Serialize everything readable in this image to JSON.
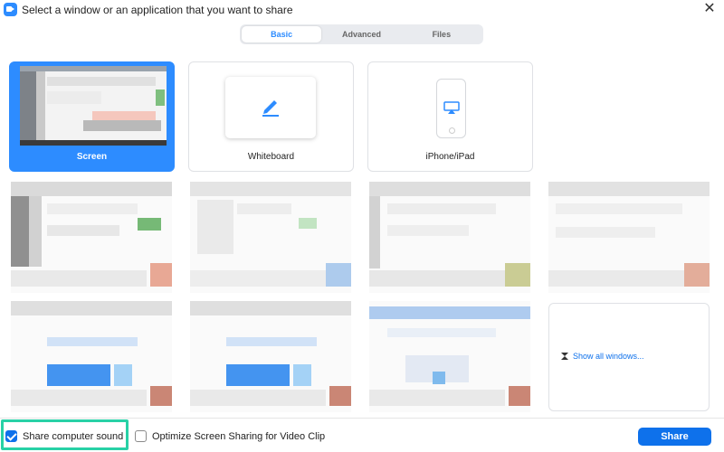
{
  "window": {
    "title": "Select a window or an application that you want to share",
    "close_glyph": "✕"
  },
  "tabs": [
    {
      "label": "Basic",
      "active": true
    },
    {
      "label": "Advanced",
      "active": false
    },
    {
      "label": "Files",
      "active": false
    }
  ],
  "sources": [
    {
      "label": "Screen",
      "selected": true,
      "icon": "screen-thumbnail"
    },
    {
      "label": "Whiteboard",
      "selected": false,
      "icon": "pencil-icon"
    },
    {
      "label": "iPhone/iPad",
      "selected": false,
      "icon": "airplay-icon"
    }
  ],
  "windows_panel": {
    "show_all_label": "Show all windows..."
  },
  "footer": {
    "share_sound": {
      "label": "Share computer sound",
      "checked": true
    },
    "optimize_video": {
      "label": "Optimize Screen Sharing for Video Clip",
      "checked": false
    },
    "share_button": "Share"
  },
  "colors": {
    "accent": "#2d8cff",
    "button": "#0e71eb",
    "highlight": "#28d1a6"
  }
}
